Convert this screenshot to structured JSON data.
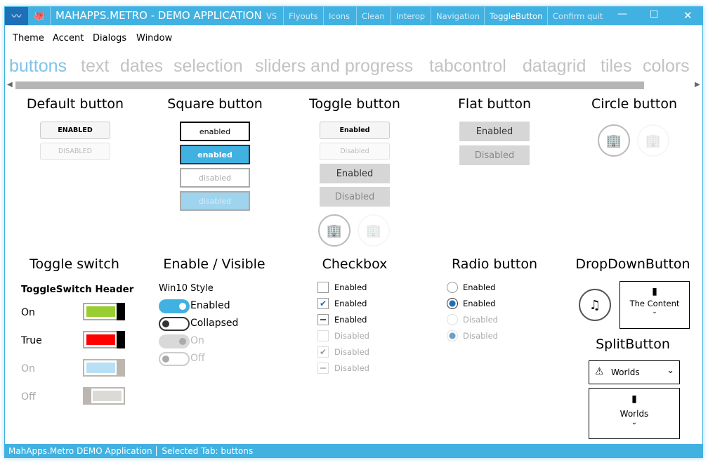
{
  "window": {
    "title": "MAHAPPS.METRO - DEMO APPLICATION",
    "title_buttons": [
      "VS",
      "Flyouts",
      "Icons",
      "Clean",
      "Interop",
      "Navigation",
      "ToggleButton",
      "Confirm quit"
    ],
    "accent": "#41B1E1"
  },
  "menu": [
    "Theme",
    "Accent",
    "Dialogs",
    "Window"
  ],
  "tabs": [
    "buttons",
    "text",
    "dates",
    "selection",
    "sliders and progress",
    "tabcontrol",
    "datagrid",
    "tiles",
    "colors"
  ],
  "sections": {
    "default": {
      "title": "Default button",
      "enabled": "ENABLED",
      "disabled": "DISABLED"
    },
    "square": {
      "title": "Square button",
      "items": [
        "enabled",
        "enabled",
        "disabled",
        "disabled"
      ]
    },
    "toggle": {
      "title": "Toggle button",
      "items": [
        "Enabled",
        "Disabled",
        "Enabled",
        "Disabled"
      ]
    },
    "flat": {
      "title": "Flat button",
      "items": [
        "Enabled",
        "Disabled"
      ]
    },
    "circle": {
      "title": "Circle button"
    },
    "toggleswitch": {
      "title": "Toggle switch",
      "header": "ToggleSwitch Header",
      "items": [
        {
          "label": "On",
          "state": "on",
          "color": "#9ACD32"
        },
        {
          "label": "True",
          "state": "on",
          "color": "#FF0000"
        },
        {
          "label": "On",
          "state": "on-disabled"
        },
        {
          "label": "Off",
          "state": "off-disabled"
        }
      ]
    },
    "enable": {
      "title": "Enable / Visible",
      "subtitle": "Win10 Style",
      "items": [
        "Enabled",
        "Collapsed",
        "On",
        "Off"
      ]
    },
    "checkbox": {
      "title": "Checkbox",
      "items": [
        "Enabled",
        "Enabled",
        "Enabled",
        "Disabled",
        "Disabled",
        "Disabled"
      ]
    },
    "radio": {
      "title": "Radio button",
      "items": [
        "Enabled",
        "Enabled",
        "Disabled",
        "Disabled"
      ]
    },
    "dropdown": {
      "title": "DropDownButton",
      "content": "The Content"
    },
    "split": {
      "title": "SplitButton",
      "value": "Worlds",
      "value2": "Worlds"
    }
  },
  "status": {
    "app": "MahApps.Metro DEMO Application",
    "tab": "Selected Tab:  buttons"
  }
}
